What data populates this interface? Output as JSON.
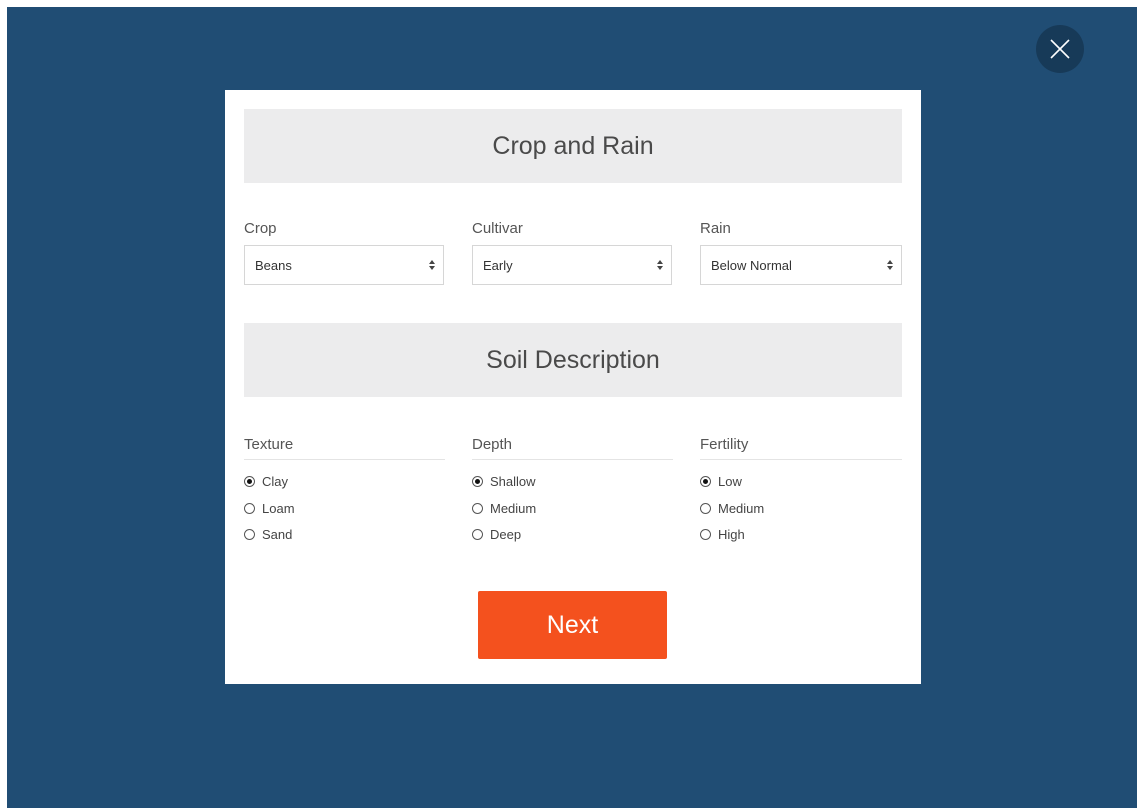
{
  "colors": {
    "backdrop": "#204d74",
    "close_button": "#173a58",
    "section_header_bg": "#ececed",
    "next_button": "#f4511e"
  },
  "close_button": {
    "icon": "close-icon"
  },
  "sections": {
    "crop_rain": {
      "title": "Crop and Rain"
    },
    "soil": {
      "title": "Soil Description"
    }
  },
  "fields": {
    "crop": {
      "label": "Crop",
      "value": "Beans"
    },
    "cultivar": {
      "label": "Cultivar",
      "value": "Early"
    },
    "rain": {
      "label": "Rain",
      "value": "Below Normal"
    }
  },
  "soil_groups": {
    "texture": {
      "title": "Texture",
      "options": [
        {
          "label": "Clay",
          "checked": true
        },
        {
          "label": "Loam",
          "checked": false
        },
        {
          "label": "Sand",
          "checked": false
        }
      ]
    },
    "depth": {
      "title": "Depth",
      "options": [
        {
          "label": "Shallow",
          "checked": true
        },
        {
          "label": "Medium",
          "checked": false
        },
        {
          "label": "Deep",
          "checked": false
        }
      ]
    },
    "fertility": {
      "title": "Fertility",
      "options": [
        {
          "label": "Low",
          "checked": true
        },
        {
          "label": "Medium",
          "checked": false
        },
        {
          "label": "High",
          "checked": false
        }
      ]
    }
  },
  "next_button": {
    "label": "Next"
  }
}
